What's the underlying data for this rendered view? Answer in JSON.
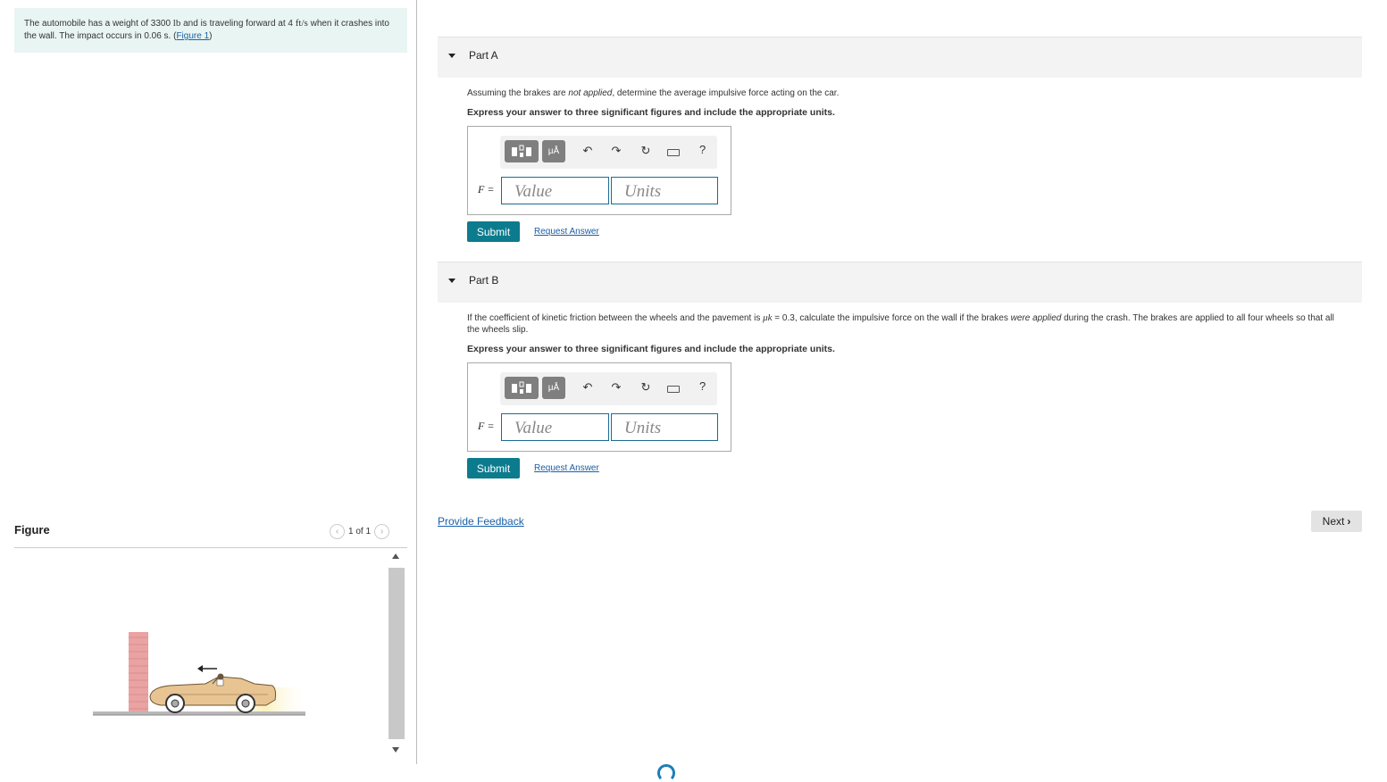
{
  "problem": {
    "text_1": "The automobile has a weight of 3300 ",
    "weight_unit": "lb",
    "text_2": " and is traveling forward at 4 ",
    "speed_unit": "ft/s",
    "text_3": " when it crashes into the wall. The impact occurs in 0.06 s. (",
    "figure_link": "Figure 1",
    "text_4": ")"
  },
  "figure": {
    "title": "Figure",
    "page_indicator": "1 of 1"
  },
  "part_a": {
    "title": "Part A",
    "question_1": "Assuming the brakes are ",
    "question_em": "not applied",
    "question_2": ", determine the average impulsive force acting on the car.",
    "express": "Express your answer to three significant figures and include the appropriate units.",
    "var_label": "F =",
    "value_placeholder": "Value",
    "units_placeholder": "Units",
    "submit": "Submit",
    "request": "Request Answer"
  },
  "part_b": {
    "title": "Part B",
    "question_1": "If the coefficient of kinetic friction between the wheels and the pavement is ",
    "mu": "μk",
    "question_2": " = 0.3, calculate the impulsive force on the wall if the brakes ",
    "question_em": "were applied",
    "question_3": " during the crash. The brakes are applied to all four wheels so that all the wheels slip.",
    "express": "Express your answer to three significant figures and include the appropriate units.",
    "var_label": "F =",
    "value_placeholder": "Value",
    "units_placeholder": "Units",
    "submit": "Submit",
    "request": "Request Answer"
  },
  "toolbar": {
    "units_button": "μÅ",
    "undo": "↶",
    "redo": "↷",
    "reset": "↻",
    "help": "?"
  },
  "footer": {
    "feedback": "Provide Feedback",
    "next": "Next"
  },
  "colors": {
    "accent": "#0c7b8e",
    "link": "#1a5fa8",
    "problem_bg": "#e9f5f3"
  },
  "icons": {
    "template": "template-icon",
    "undo": "undo-icon",
    "redo": "redo-icon",
    "reset": "reset-icon",
    "keyboard": "keyboard-icon",
    "help": "help-icon"
  }
}
